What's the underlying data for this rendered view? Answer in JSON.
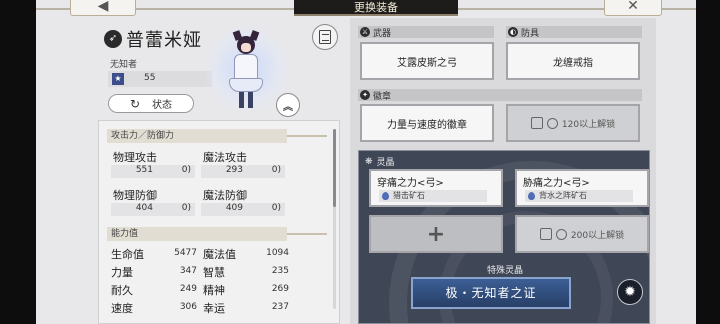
{
  "header": {
    "title": "更换装备"
  },
  "nav": {
    "back_icon": "arrow-left-icon",
    "close_icon": "close-icon"
  },
  "character": {
    "name": "普蕾米娅",
    "title": "无知者",
    "level": "55",
    "status_label": "状态"
  },
  "stats": {
    "attack_header": "攻击力／防御力",
    "attack": [
      {
        "name": "物理攻击",
        "base": "551",
        "bonus": "0)"
      },
      {
        "name": "魔法攻击",
        "base": "293",
        "bonus": "0)"
      },
      {
        "name": "物理防御",
        "base": "404",
        "bonus": "0)"
      },
      {
        "name": "魔法防御",
        "base": "409",
        "bonus": "0)"
      }
    ],
    "ability_header": "能力值",
    "attributes": [
      {
        "name": "生命值",
        "value": "5477"
      },
      {
        "name": "魔法值",
        "value": "1094"
      },
      {
        "name": "力量",
        "value": "347"
      },
      {
        "name": "智慧",
        "value": "235"
      },
      {
        "name": "耐久",
        "value": "249"
      },
      {
        "name": "精神",
        "value": "269"
      },
      {
        "name": "速度",
        "value": "306"
      },
      {
        "name": "幸运",
        "value": "237"
      }
    ]
  },
  "equipment": {
    "weapon_label": "武器",
    "weapon": "艾露皮斯之弓",
    "armor_label": "防具",
    "armor": "龙缠戒指",
    "badge_label": "徽章",
    "badge": "力量与速度的徽章",
    "badge_locked": "120以上解锁",
    "crystal_label": "灵晶",
    "crystals": [
      {
        "name": "穿痛之力<弓>",
        "source": "猎击矿石"
      },
      {
        "name": "胁痛之力<弓>",
        "source": "背水之阵矿石"
      }
    ],
    "crystal_locked": "200以上解锁",
    "special_label": "特殊灵晶",
    "special_name": "极・无知者之证"
  }
}
